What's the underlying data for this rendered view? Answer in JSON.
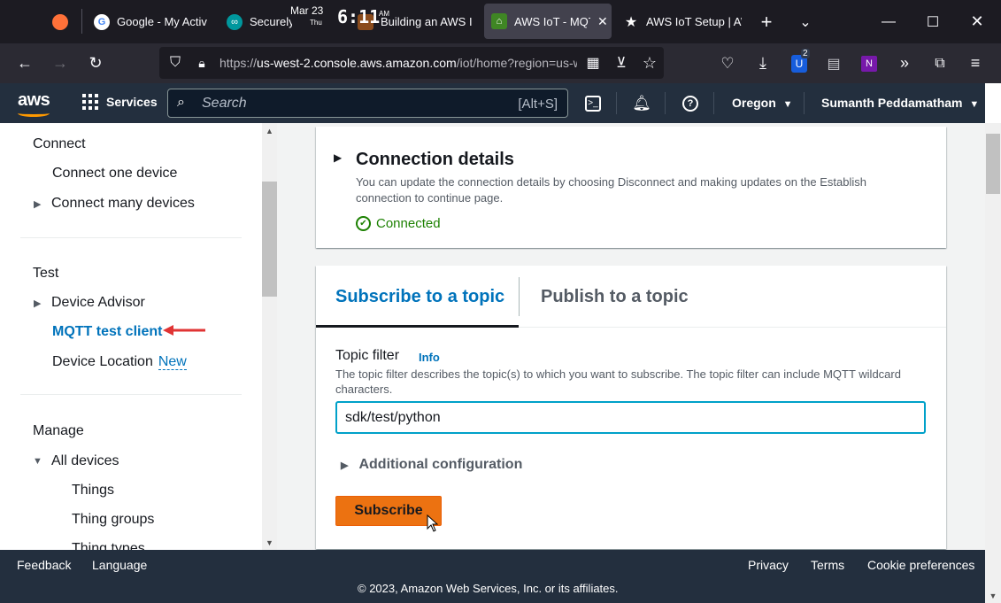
{
  "browser": {
    "tabs": [
      {
        "title": "Google - My Activit",
        "icon": "google-icon"
      },
      {
        "title": "Securely Connect",
        "icon": "arduino-icon"
      },
      {
        "title": "Building an AWS Io",
        "icon": "hexagon-icon"
      },
      {
        "title": "AWS IoT - MQTT",
        "icon": "aws-iot-icon",
        "active": true
      },
      {
        "title": "AWS IoT Setup | AW",
        "icon": "star-icon"
      }
    ],
    "clock": {
      "date": "Mar 23",
      "weekday": "Thu",
      "time": "6:11",
      "ampm": "AM"
    },
    "url": {
      "prefix": "https://",
      "domain": "us-west-2.console.aws.amazon.com",
      "path": "/iot/home?region=us-w"
    },
    "badge_count": "2"
  },
  "aws_header": {
    "logo": "aws",
    "services_label": "Services",
    "search_placeholder": "Search",
    "search_shortcut": "[Alt+S]",
    "region": "Oregon",
    "user": "Sumanth Peddamatham"
  },
  "sidebar": {
    "connect": {
      "heading": "Connect",
      "items": [
        "Connect one device",
        "Connect many devices"
      ]
    },
    "test": {
      "heading": "Test",
      "items": [
        "Device Advisor",
        "MQTT test client",
        "Device Location"
      ],
      "new_badge": "New"
    },
    "manage": {
      "heading": "Manage",
      "items": [
        "All devices",
        "Things",
        "Thing groups",
        "Thing types"
      ]
    }
  },
  "connection": {
    "title": "Connection details",
    "description": "You can update the connection details by choosing Disconnect and making updates on the Establish connection to continue page.",
    "status": "Connected"
  },
  "mqtt": {
    "tabs": [
      "Subscribe to a topic",
      "Publish to a topic"
    ],
    "topic_filter_label": "Topic filter",
    "info_link": "Info",
    "topic_filter_desc": "The topic filter describes the topic(s) to which you want to subscribe. The topic filter can include MQTT wildcard characters.",
    "topic_filter_value": "sdk/test/python",
    "additional_config": "Additional configuration",
    "subscribe_button": "Subscribe"
  },
  "footer": {
    "links_left": [
      "Feedback",
      "Language"
    ],
    "links_right": [
      "Privacy",
      "Terms",
      "Cookie preferences"
    ],
    "copyright": "© 2023, Amazon Web Services, Inc. or its affiliates."
  },
  "colors": {
    "accent": "#0073bb",
    "primary_button": "#ec7211",
    "header_bg": "#232f3e",
    "status_ok": "#1d8102"
  }
}
